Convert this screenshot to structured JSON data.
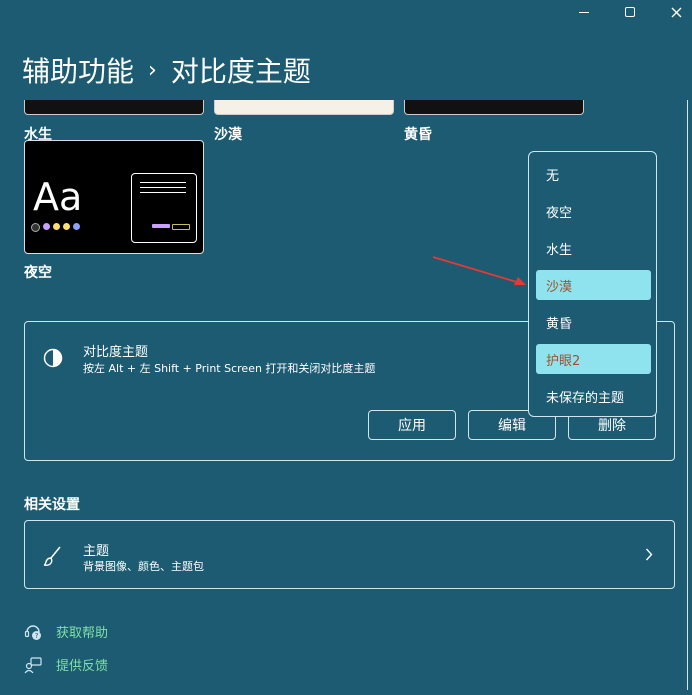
{
  "window": {
    "minimize_icon": "minimize-icon",
    "maximize_icon": "maximize-icon",
    "close_icon": "close-icon"
  },
  "breadcrumb": {
    "parent": "辅助功能",
    "separator": "›",
    "current": "对比度主题"
  },
  "themes": {
    "top_labels": [
      "水生",
      "沙漠",
      "黄昏"
    ],
    "night_label": "夜空",
    "night_preview_text": "Aa",
    "dot_colors": [
      "#333333",
      "#c9a0ff",
      "#ffe066",
      "#ffe066",
      "#8fa0ff"
    ]
  },
  "contrast_card": {
    "title": "对比度主题",
    "description": "按左 Alt + 左 Shift + Print Screen 打开和关闭对比度主题",
    "apply_label": "应用",
    "edit_label": "编辑",
    "delete_label": "删除"
  },
  "dropdown": {
    "options": [
      "无",
      "夜空",
      "水生",
      "沙漠",
      "黄昏",
      "护眼2",
      "未保存的主题"
    ],
    "highlighted": [
      "沙漠",
      "护眼2"
    ]
  },
  "related": {
    "heading": "相关设置",
    "theme_title": "主题",
    "theme_description": "背景图像、颜色、主题包"
  },
  "links": {
    "help": "获取帮助",
    "feedback": "提供反馈"
  },
  "colors": {
    "background": "#1c5b72",
    "highlight": "#8fe3ee",
    "link": "#7fe0a8",
    "arrow": "#e53935"
  }
}
